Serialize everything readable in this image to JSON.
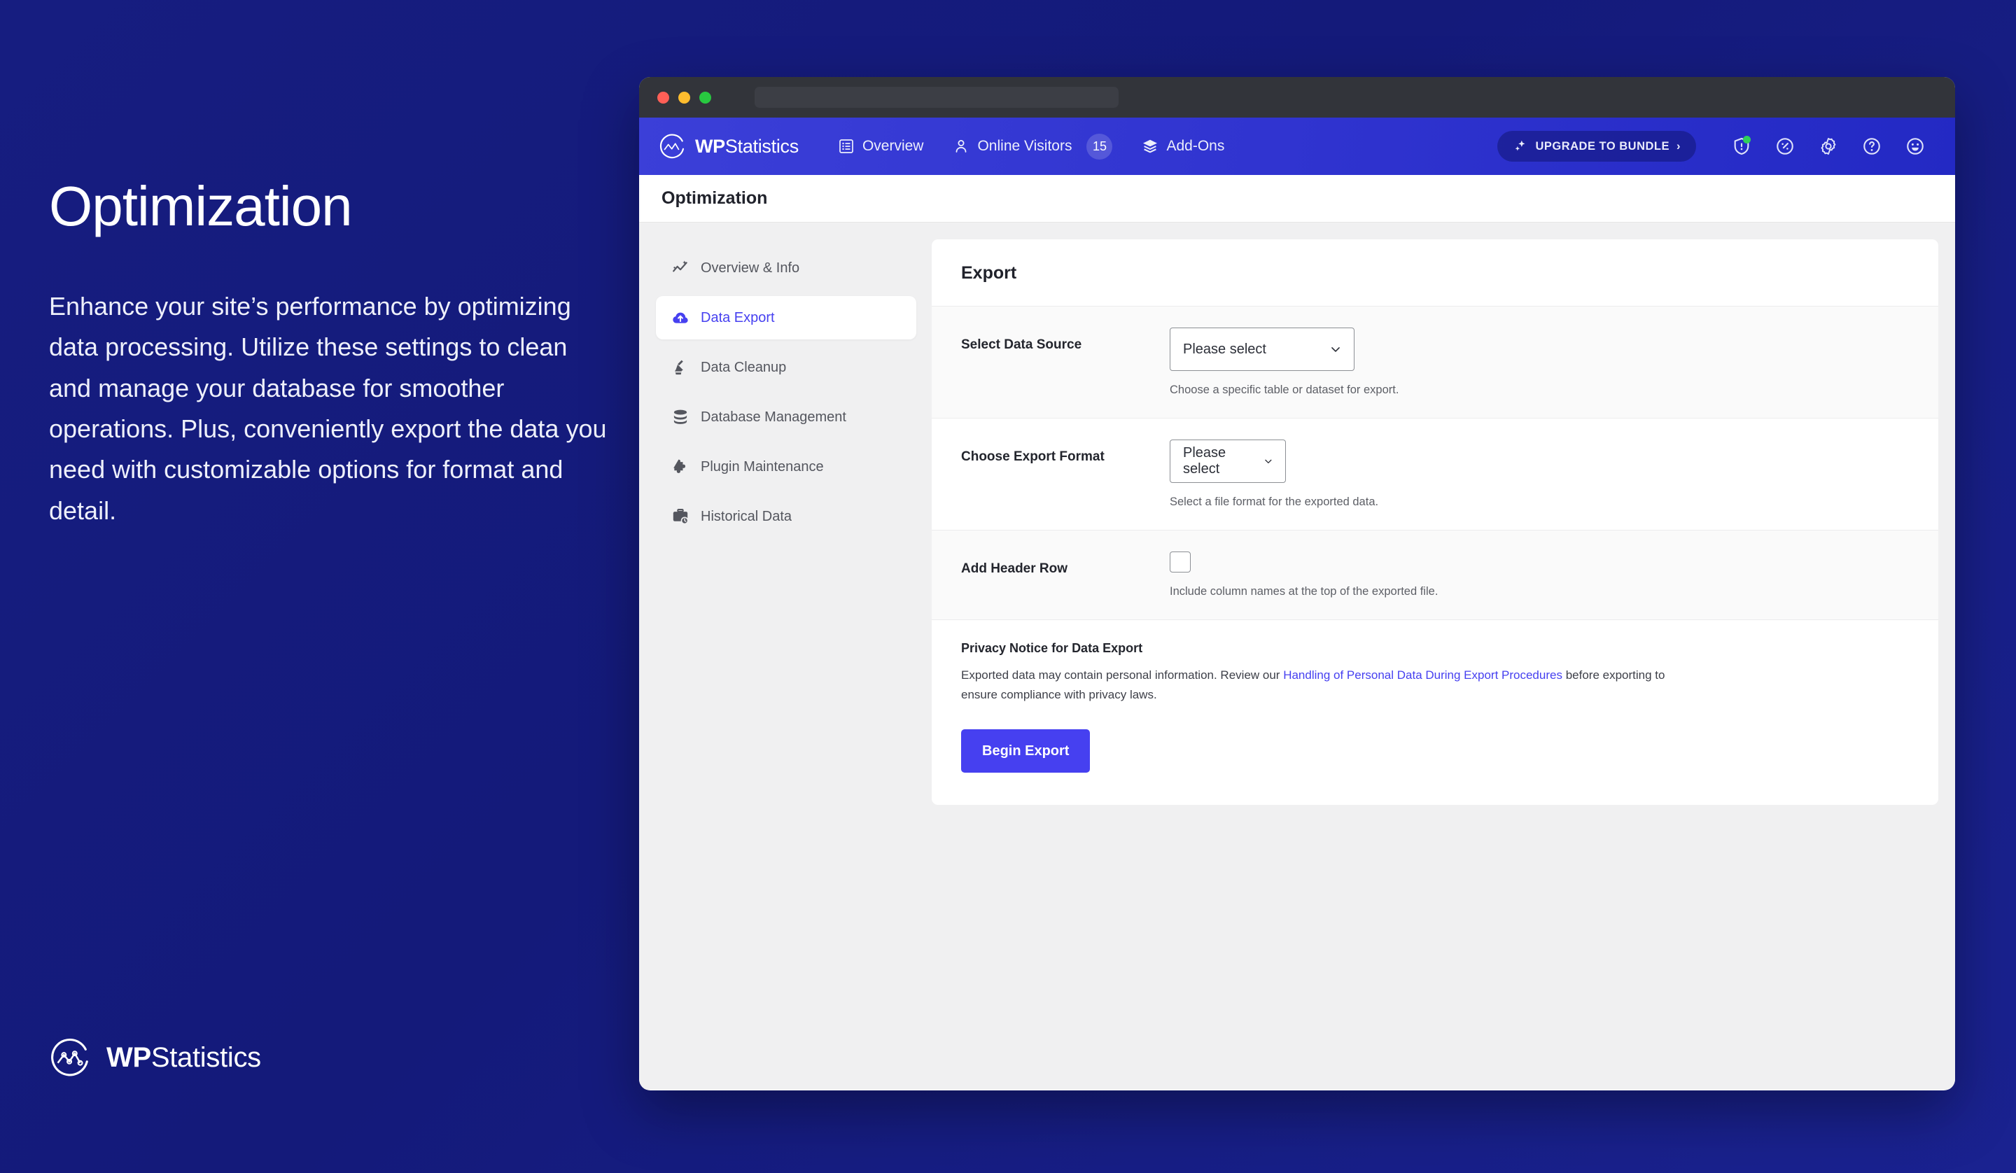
{
  "promo": {
    "title": "Optimization",
    "body": "Enhance your site’s performance by optimizing data processing. Utilize these settings to clean and manage your database for smoother operations. Plus, conveniently export the data you need with customizable options for format and detail.",
    "logo_bold": "WP",
    "logo_light": "Statistics"
  },
  "browser": {
    "url": ""
  },
  "header": {
    "brand_bold": "WP",
    "brand_light": "Statistics",
    "nav": [
      {
        "label": "Overview",
        "icon": "list-icon"
      },
      {
        "label": "Online Visitors",
        "icon": "user-icon",
        "badge": "15"
      },
      {
        "label": "Add-Ons",
        "icon": "layers-icon"
      }
    ],
    "upgrade_label": "UPGRADE TO BUNDLE",
    "upgrade_chevron": "›",
    "icons": [
      {
        "name": "shield-icon",
        "notification": true
      },
      {
        "name": "speedometer-icon"
      },
      {
        "name": "gear-icon"
      },
      {
        "name": "help-icon"
      },
      {
        "name": "smiley-icon"
      }
    ]
  },
  "page": {
    "title": "Optimization"
  },
  "sidebar": {
    "items": [
      {
        "label": "Overview & Info",
        "icon": "trend-sparkle-icon",
        "active": false
      },
      {
        "label": "Data Export",
        "icon": "cloud-upload-icon",
        "active": true
      },
      {
        "label": "Data Cleanup",
        "icon": "broom-icon",
        "active": false
      },
      {
        "label": "Database Management",
        "icon": "database-icon",
        "active": false
      },
      {
        "label": "Plugin Maintenance",
        "icon": "puzzle-icon",
        "active": false
      },
      {
        "label": "Historical Data",
        "icon": "briefcase-clock-icon",
        "active": false
      }
    ]
  },
  "export_card": {
    "title": "Export",
    "rows": [
      {
        "label": "Select Data Source",
        "control": "select",
        "value": "Please select",
        "hint": "Choose a specific table or dataset for export."
      },
      {
        "label": "Choose Export Format",
        "control": "select",
        "value": "Please select",
        "hint": "Select a file format for the exported data."
      },
      {
        "label": "Add Header Row",
        "control": "checkbox",
        "checked": false,
        "hint": "Include column names at the top of the exported file."
      }
    ],
    "notice": {
      "title": "Privacy Notice for Data Export",
      "text_before": "Exported data may contain personal information. Review our ",
      "link": "Handling of Personal Data During Export Procedures",
      "text_after": " before exporting to ensure compliance with privacy laws."
    },
    "submit_label": "Begin Export"
  },
  "colors": {
    "page_bg": "#141a7a",
    "header_blue": "#3b3fd8",
    "accent": "#4640f0",
    "notification_green": "#2fd15a"
  }
}
